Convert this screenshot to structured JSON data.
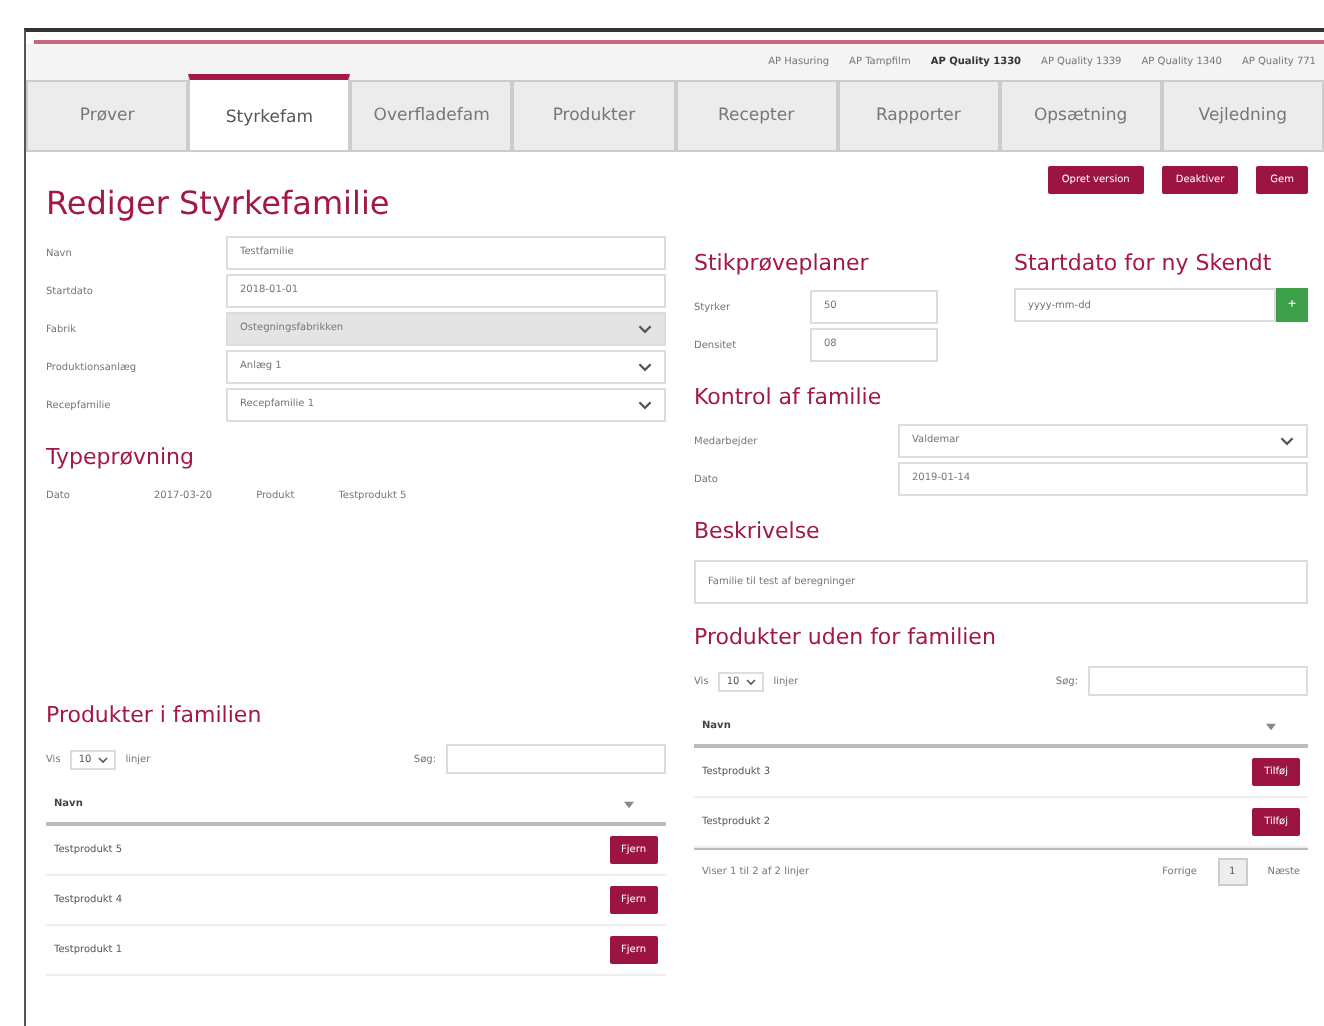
{
  "top_links": [
    {
      "label": "AP Hasuring",
      "selected": false
    },
    {
      "label": "AP Tampfilm",
      "selected": false
    },
    {
      "label": "AP Quality 1330",
      "selected": true
    },
    {
      "label": "AP Quality 1339",
      "selected": false
    },
    {
      "label": "AP Quality 1340",
      "selected": false
    },
    {
      "label": "AP Quality 771",
      "selected": false
    }
  ],
  "tabs": [
    {
      "label": "Prøver",
      "selected": false
    },
    {
      "label": "Styrkefam",
      "selected": true
    },
    {
      "label": "Overfladefam",
      "selected": false
    },
    {
      "label": "Produkter",
      "selected": false
    },
    {
      "label": "Recepter",
      "selected": false
    },
    {
      "label": "Rapporter",
      "selected": false
    },
    {
      "label": "Opsætning",
      "selected": false
    },
    {
      "label": "Vejledning",
      "selected": false
    }
  ],
  "page_title": "Rediger Styrkefamilie",
  "actions": [
    "Opret version",
    "Deaktiver",
    "Gem"
  ],
  "form": [
    {
      "label": "Navn",
      "value": "Testfamilie",
      "kind": "text",
      "disabled": false
    },
    {
      "label": "Startdato",
      "value": "2018-01-01",
      "kind": "text",
      "disabled": false
    },
    {
      "label": "Fabrik",
      "value": "Ostegningsfabrikken",
      "kind": "select",
      "disabled": true
    },
    {
      "label": "Produktionsanlæg",
      "value": "Anlæg 1",
      "kind": "select",
      "disabled": false
    },
    {
      "label": "Recepfamilie",
      "value": "Recepfamilie 1",
      "kind": "select",
      "disabled": false
    }
  ],
  "typeproevning": {
    "title": "Typeprøvning",
    "date_label": "Dato",
    "date": "2017-03-20",
    "product_label": "Produkt",
    "product": "Testprodukt 5"
  },
  "stikproeveplaner": {
    "title": "Stikprøveplaner",
    "rows": [
      {
        "label": "Styrker",
        "value": "50"
      },
      {
        "label": "Densitet",
        "value": "08"
      }
    ]
  },
  "startdato": {
    "title": "Startdato for ny Skendt",
    "placeholder": "yyyy-mm-dd",
    "button": "+"
  },
  "kontrol": {
    "title": "Kontrol af familie",
    "rows": [
      {
        "label": "Medarbejder",
        "value": "Valdemar",
        "kind": "select"
      },
      {
        "label": "Dato",
        "value": "2019-01-14",
        "kind": "text"
      }
    ]
  },
  "beskrivelse": {
    "title": "Beskrivelse",
    "value": "Familie til test af beregninger"
  },
  "tables": [
    {
      "title": "Produkter i familien",
      "show_label": "Vis",
      "page_size": "10",
      "lines_label": "linjer",
      "search_label": "Søg:",
      "column": "Navn",
      "rows": [
        {
          "name": "Testprodukt 5",
          "action": "Fjern"
        },
        {
          "name": "Testprodukt 4",
          "action": "Fjern"
        },
        {
          "name": "Testprodukt 1",
          "action": "Fjern"
        }
      ]
    },
    {
      "title": "Produkter uden for familien",
      "show_label": "Vis",
      "page_size": "10",
      "lines_label": "linjer",
      "search_label": "Søg:",
      "column": "Navn",
      "rows": [
        {
          "name": "Testprodukt 3",
          "action": "Tilføj"
        },
        {
          "name": "Testprodukt 2",
          "action": "Tilføj"
        }
      ],
      "info": "Viser 1 til 2 af 2 linjer",
      "pager": {
        "prev": "Forrige",
        "page": "1",
        "next": "Næste"
      }
    }
  ]
}
